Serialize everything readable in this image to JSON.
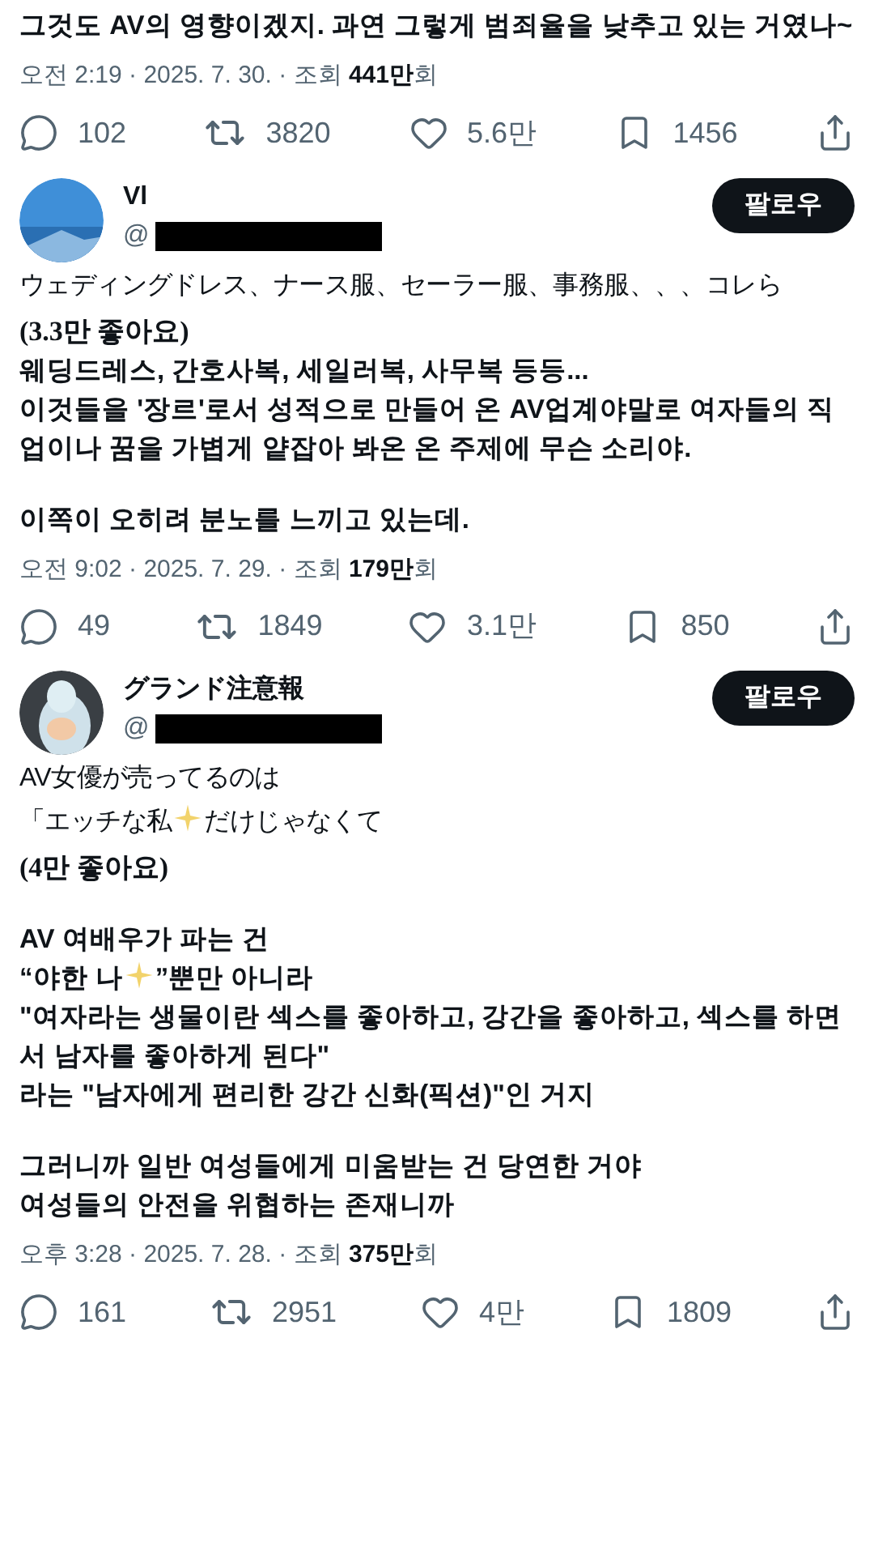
{
  "segments": [
    {
      "translation": [
        {
          "kind": "body",
          "parts": [
            {
              "kind": "text",
              "text": "그것도 AV의 영향이겠지. 과연 그렇게 범죄율을 낮추고 있는 거였나~"
            }
          ]
        }
      ],
      "meta": {
        "time": "오전 2:19 · 2025. 7. 30. · 조회 ",
        "views": "441만",
        "suffix": "회"
      },
      "actions": {
        "replies": "102",
        "reposts": "3820",
        "likes": "5.6만",
        "bookmarks": "1456"
      }
    },
    {
      "author": {
        "name": "Vl",
        "handle": "@",
        "follow": "팔로우"
      },
      "original": [
        [
          {
            "kind": "text",
            "text": "ウェディングドレス、ナース服、セーラー服、事務服、、、コレら"
          }
        ]
      ],
      "translation": [
        {
          "kind": "likes",
          "parts": [
            {
              "kind": "text",
              "text": "(3.3만 좋아요)"
            }
          ]
        },
        {
          "kind": "body",
          "parts": [
            {
              "kind": "text",
              "text": "웨딩드레스, 간호사복, 세일러복, 사무복 등등..."
            }
          ]
        },
        {
          "kind": "body",
          "parts": [
            {
              "kind": "text",
              "text": "이것들을 '장르'로서 성적으로 만들어 온 AV업계야말로 여자들의 직업이나 꿈을 가볍게 얕잡아 봐온 온 주제에 무슨 소리야."
            }
          ]
        },
        {
          "kind": "gap"
        },
        {
          "kind": "body",
          "parts": [
            {
              "kind": "text",
              "text": "이쪽이 오히려 분노를 느끼고 있는데."
            }
          ]
        }
      ],
      "meta": {
        "time": "오전 9:02 · 2025. 7. 29. · 조회 ",
        "views": "179만",
        "suffix": "회"
      },
      "actions": {
        "replies": "49",
        "reposts": "1849",
        "likes": "3.1만",
        "bookmarks": "850"
      }
    },
    {
      "author": {
        "name": "グランド注意報",
        "handle": "@",
        "follow": "팔로우"
      },
      "original": [
        [
          {
            "kind": "text",
            "text": "AV女優が売ってるのは"
          }
        ],
        [
          {
            "kind": "text",
            "text": "「エッチな私"
          },
          {
            "kind": "sparkle"
          },
          {
            "kind": "text",
            "text": "だけじゃなくて"
          }
        ]
      ],
      "translation": [
        {
          "kind": "likes",
          "parts": [
            {
              "kind": "text",
              "text": "(4만 좋아요)"
            }
          ]
        },
        {
          "kind": "gap"
        },
        {
          "kind": "body",
          "parts": [
            {
              "kind": "text",
              "text": "AV 여배우가 파는 건"
            }
          ]
        },
        {
          "kind": "body",
          "parts": [
            {
              "kind": "text",
              "text": "“야한 나"
            },
            {
              "kind": "sparkle"
            },
            {
              "kind": "text",
              "text": "”뿐만 아니라"
            }
          ]
        },
        {
          "kind": "body",
          "parts": [
            {
              "kind": "text",
              "text": "\"여자라는 생물이란 섹스를 좋아하고, 강간을 좋아하고, 섹스를 하면서 남자를 좋아하게 된다\""
            }
          ]
        },
        {
          "kind": "body",
          "parts": [
            {
              "kind": "text",
              "text": "라는 \"남자에게 편리한 강간 신화(픽션)\"인 거지"
            }
          ]
        },
        {
          "kind": "gap"
        },
        {
          "kind": "body",
          "parts": [
            {
              "kind": "text",
              "text": "그러니까 일반 여성들에게 미움받는 건 당연한 거야"
            }
          ]
        },
        {
          "kind": "body",
          "parts": [
            {
              "kind": "text",
              "text": "여성들의 안전을 위협하는 존재니까"
            }
          ]
        }
      ],
      "meta": {
        "time": "오후 3:28 · 2025. 7. 28. · 조회 ",
        "views": "375만",
        "suffix": "회"
      },
      "actions": {
        "replies": "161",
        "reposts": "2951",
        "likes": "4만",
        "bookmarks": "1809"
      }
    }
  ]
}
